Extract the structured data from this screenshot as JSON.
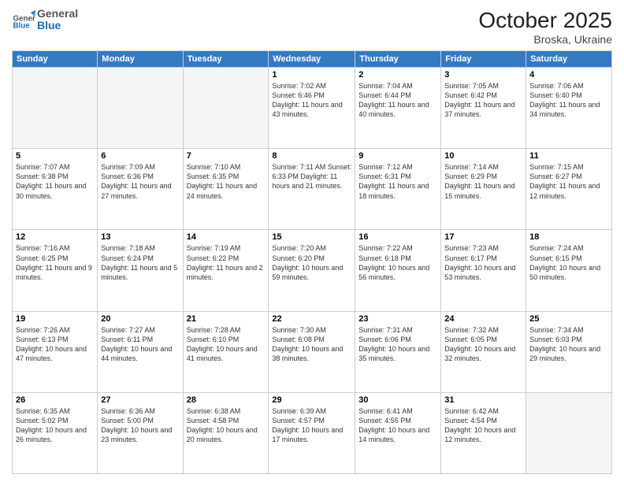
{
  "header": {
    "logo_general": "General",
    "logo_blue": "Blue",
    "month_title": "October 2025",
    "location": "Broska, Ukraine"
  },
  "weekdays": [
    "Sunday",
    "Monday",
    "Tuesday",
    "Wednesday",
    "Thursday",
    "Friday",
    "Saturday"
  ],
  "weeks": [
    [
      {
        "num": "",
        "info": ""
      },
      {
        "num": "",
        "info": ""
      },
      {
        "num": "",
        "info": ""
      },
      {
        "num": "1",
        "info": "Sunrise: 7:02 AM\nSunset: 6:46 PM\nDaylight: 11 hours and 43 minutes."
      },
      {
        "num": "2",
        "info": "Sunrise: 7:04 AM\nSunset: 6:44 PM\nDaylight: 11 hours and 40 minutes."
      },
      {
        "num": "3",
        "info": "Sunrise: 7:05 AM\nSunset: 6:42 PM\nDaylight: 11 hours and 37 minutes."
      },
      {
        "num": "4",
        "info": "Sunrise: 7:06 AM\nSunset: 6:40 PM\nDaylight: 11 hours and 34 minutes."
      }
    ],
    [
      {
        "num": "5",
        "info": "Sunrise: 7:07 AM\nSunset: 6:38 PM\nDaylight: 11 hours and 30 minutes."
      },
      {
        "num": "6",
        "info": "Sunrise: 7:09 AM\nSunset: 6:36 PM\nDaylight: 11 hours and 27 minutes."
      },
      {
        "num": "7",
        "info": "Sunrise: 7:10 AM\nSunset: 6:35 PM\nDaylight: 11 hours and 24 minutes."
      },
      {
        "num": "8",
        "info": "Sunrise: 7:11 AM\nSunset: 6:33 PM\nDaylight: 11 hours and 21 minutes."
      },
      {
        "num": "9",
        "info": "Sunrise: 7:12 AM\nSunset: 6:31 PM\nDaylight: 11 hours and 18 minutes."
      },
      {
        "num": "10",
        "info": "Sunrise: 7:14 AM\nSunset: 6:29 PM\nDaylight: 11 hours and 15 minutes."
      },
      {
        "num": "11",
        "info": "Sunrise: 7:15 AM\nSunset: 6:27 PM\nDaylight: 11 hours and 12 minutes."
      }
    ],
    [
      {
        "num": "12",
        "info": "Sunrise: 7:16 AM\nSunset: 6:25 PM\nDaylight: 11 hours and 9 minutes."
      },
      {
        "num": "13",
        "info": "Sunrise: 7:18 AM\nSunset: 6:24 PM\nDaylight: 11 hours and 5 minutes."
      },
      {
        "num": "14",
        "info": "Sunrise: 7:19 AM\nSunset: 6:22 PM\nDaylight: 11 hours and 2 minutes."
      },
      {
        "num": "15",
        "info": "Sunrise: 7:20 AM\nSunset: 6:20 PM\nDaylight: 10 hours and 59 minutes."
      },
      {
        "num": "16",
        "info": "Sunrise: 7:22 AM\nSunset: 6:18 PM\nDaylight: 10 hours and 56 minutes."
      },
      {
        "num": "17",
        "info": "Sunrise: 7:23 AM\nSunset: 6:17 PM\nDaylight: 10 hours and 53 minutes."
      },
      {
        "num": "18",
        "info": "Sunrise: 7:24 AM\nSunset: 6:15 PM\nDaylight: 10 hours and 50 minutes."
      }
    ],
    [
      {
        "num": "19",
        "info": "Sunrise: 7:26 AM\nSunset: 6:13 PM\nDaylight: 10 hours and 47 minutes."
      },
      {
        "num": "20",
        "info": "Sunrise: 7:27 AM\nSunset: 6:11 PM\nDaylight: 10 hours and 44 minutes."
      },
      {
        "num": "21",
        "info": "Sunrise: 7:28 AM\nSunset: 6:10 PM\nDaylight: 10 hours and 41 minutes."
      },
      {
        "num": "22",
        "info": "Sunrise: 7:30 AM\nSunset: 6:08 PM\nDaylight: 10 hours and 38 minutes."
      },
      {
        "num": "23",
        "info": "Sunrise: 7:31 AM\nSunset: 6:06 PM\nDaylight: 10 hours and 35 minutes."
      },
      {
        "num": "24",
        "info": "Sunrise: 7:32 AM\nSunset: 6:05 PM\nDaylight: 10 hours and 32 minutes."
      },
      {
        "num": "25",
        "info": "Sunrise: 7:34 AM\nSunset: 6:03 PM\nDaylight: 10 hours and 29 minutes."
      }
    ],
    [
      {
        "num": "26",
        "info": "Sunrise: 6:35 AM\nSunset: 5:02 PM\nDaylight: 10 hours and 26 minutes."
      },
      {
        "num": "27",
        "info": "Sunrise: 6:36 AM\nSunset: 5:00 PM\nDaylight: 10 hours and 23 minutes."
      },
      {
        "num": "28",
        "info": "Sunrise: 6:38 AM\nSunset: 4:58 PM\nDaylight: 10 hours and 20 minutes."
      },
      {
        "num": "29",
        "info": "Sunrise: 6:39 AM\nSunset: 4:57 PM\nDaylight: 10 hours and 17 minutes."
      },
      {
        "num": "30",
        "info": "Sunrise: 6:41 AM\nSunset: 4:55 PM\nDaylight: 10 hours and 14 minutes."
      },
      {
        "num": "31",
        "info": "Sunrise: 6:42 AM\nSunset: 4:54 PM\nDaylight: 10 hours and 12 minutes."
      },
      {
        "num": "",
        "info": ""
      }
    ]
  ]
}
